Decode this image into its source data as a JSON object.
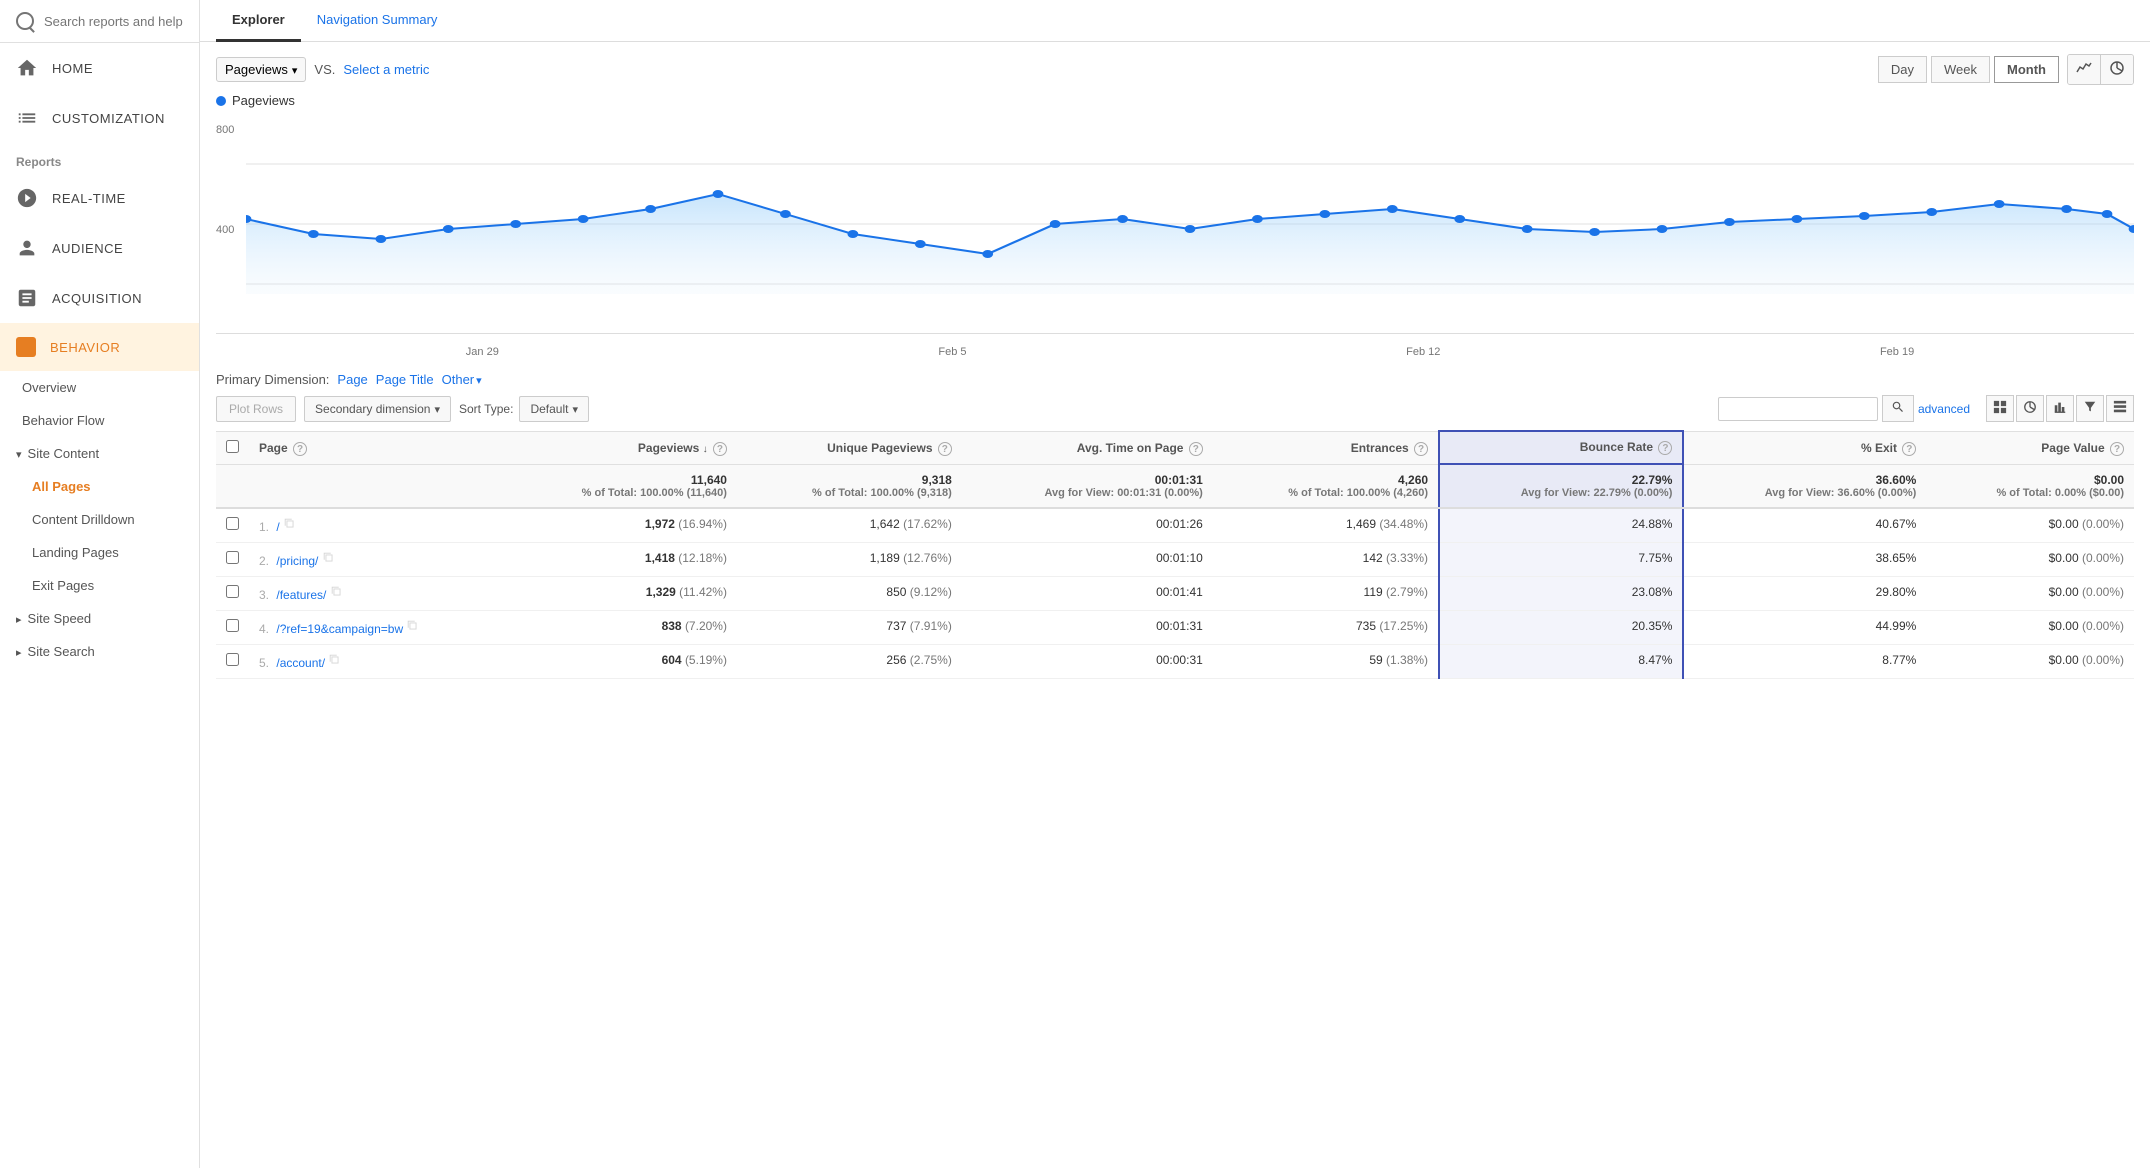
{
  "sidebar": {
    "search_placeholder": "Search reports and help",
    "nav_items": [
      {
        "label": "HOME",
        "icon": "home"
      },
      {
        "label": "CUSTOMIZATION",
        "icon": "customization"
      }
    ],
    "reports_label": "Reports",
    "report_nav": [
      {
        "label": "REAL-TIME",
        "icon": "clock"
      },
      {
        "label": "AUDIENCE",
        "icon": "person"
      },
      {
        "label": "ACQUISITION",
        "icon": "acquisition"
      },
      {
        "label": "BEHAVIOR",
        "icon": "behavior",
        "active": true
      }
    ],
    "behavior_sub": [
      {
        "label": "Overview",
        "active": false
      },
      {
        "label": "Behavior Flow",
        "active": false
      }
    ],
    "site_content": {
      "label": "Site Content",
      "items": [
        {
          "label": "All Pages",
          "active": true
        },
        {
          "label": "Content Drilldown",
          "active": false
        },
        {
          "label": "Landing Pages",
          "active": false
        },
        {
          "label": "Exit Pages",
          "active": false
        }
      ]
    },
    "site_speed": {
      "label": "Site Speed"
    },
    "site_search": {
      "label": "Site Search"
    }
  },
  "tabs": [
    {
      "label": "Explorer",
      "active": true
    },
    {
      "label": "Navigation Summary",
      "active": false
    }
  ],
  "chart": {
    "metric_dropdown": "Pageviews",
    "vs_text": "VS.",
    "select_metric": "Select a metric",
    "date_buttons": [
      "Day",
      "Week",
      "Month"
    ],
    "active_date": "Month",
    "legend_label": "Pageviews",
    "y_label_800": "800",
    "y_label_400": "400",
    "x_labels": [
      "Jan 29",
      "Feb 5",
      "Feb 12",
      "Feb 19"
    ]
  },
  "primary_dimension": {
    "label": "Primary Dimension:",
    "options": [
      "Page",
      "Page Title",
      "Other"
    ]
  },
  "table_controls": {
    "plot_rows": "Plot Rows",
    "secondary_dimension": "Secondary dimension",
    "sort_type_label": "Sort Type:",
    "sort_default": "Default",
    "search_placeholder": "",
    "advanced_link": "advanced"
  },
  "table": {
    "headers": [
      {
        "label": "Page",
        "key": "page"
      },
      {
        "label": "Pageviews",
        "sub": "↓",
        "key": "pageviews"
      },
      {
        "label": "Unique Pageviews",
        "key": "unique_pageviews"
      },
      {
        "label": "Avg. Time on Page",
        "key": "avg_time"
      },
      {
        "label": "Entrances",
        "key": "entrances"
      },
      {
        "label": "Bounce Rate",
        "key": "bounce_rate",
        "highlighted": true
      },
      {
        "label": "% Exit",
        "key": "exit"
      },
      {
        "label": "Page Value",
        "key": "page_value"
      }
    ],
    "totals": {
      "pageviews": "11,640",
      "pageviews_sub": "% of Total: 100.00% (11,640)",
      "unique_pageviews": "9,318",
      "unique_pageviews_sub": "% of Total: 100.00% (9,318)",
      "avg_time": "00:01:31",
      "avg_time_sub": "Avg for View: 00:01:31 (0.00%)",
      "entrances": "4,260",
      "entrances_sub": "% of Total: 100.00% (4,260)",
      "bounce_rate": "22.79%",
      "bounce_rate_sub": "Avg for View: 22.79% (0.00%)",
      "exit": "36.60%",
      "exit_sub": "Avg for View: 36.60% (0.00%)",
      "page_value": "$0.00",
      "page_value_sub": "% of Total: 0.00% ($0.00)"
    },
    "rows": [
      {
        "num": "1.",
        "page": "/",
        "pageviews": "1,972",
        "pageviews_pct": "(16.94%)",
        "unique_pageviews": "1,642",
        "unique_pct": "(17.62%)",
        "avg_time": "00:01:26",
        "entrances": "1,469",
        "entrances_pct": "(34.48%)",
        "bounce_rate": "24.88%",
        "exit": "40.67%",
        "page_value": "$0.00",
        "page_value_pct": "(0.00%)"
      },
      {
        "num": "2.",
        "page": "/pricing/",
        "pageviews": "1,418",
        "pageviews_pct": "(12.18%)",
        "unique_pageviews": "1,189",
        "unique_pct": "(12.76%)",
        "avg_time": "00:01:10",
        "entrances": "142",
        "entrances_pct": "(3.33%)",
        "bounce_rate": "7.75%",
        "exit": "38.65%",
        "page_value": "$0.00",
        "page_value_pct": "(0.00%)"
      },
      {
        "num": "3.",
        "page": "/features/",
        "pageviews": "1,329",
        "pageviews_pct": "(11.42%)",
        "unique_pageviews": "850",
        "unique_pct": "(9.12%)",
        "avg_time": "00:01:41",
        "entrances": "119",
        "entrances_pct": "(2.79%)",
        "bounce_rate": "23.08%",
        "exit": "29.80%",
        "page_value": "$0.00",
        "page_value_pct": "(0.00%)"
      },
      {
        "num": "4.",
        "page": "/?ref=19&campaign=bw",
        "pageviews": "838",
        "pageviews_pct": "(7.20%)",
        "unique_pageviews": "737",
        "unique_pct": "(7.91%)",
        "avg_time": "00:01:31",
        "entrances": "735",
        "entrances_pct": "(17.25%)",
        "bounce_rate": "20.35%",
        "exit": "44.99%",
        "page_value": "$0.00",
        "page_value_pct": "(0.00%)"
      },
      {
        "num": "5.",
        "page": "/account/",
        "pageviews": "604",
        "pageviews_pct": "(5.19%)",
        "unique_pageviews": "256",
        "unique_pct": "(2.75%)",
        "avg_time": "00:00:31",
        "entrances": "59",
        "entrances_pct": "(1.38%)",
        "bounce_rate": "8.47%",
        "exit": "8.77%",
        "page_value": "$0.00",
        "page_value_pct": "(0.00%)"
      }
    ]
  }
}
